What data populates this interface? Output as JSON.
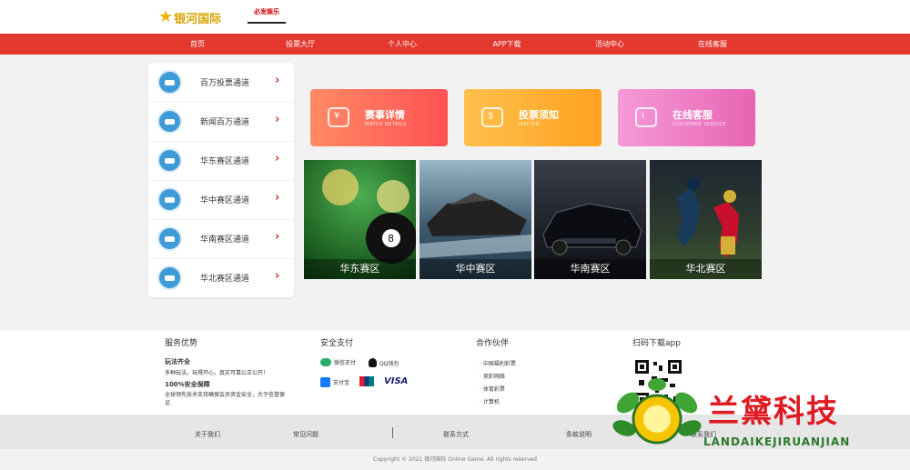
{
  "header": {
    "logo_text": "银河国际",
    "slogan": "必发娱乐"
  },
  "nav": {
    "items": [
      "首页",
      "投票大厅",
      "个人中心",
      "APP下载",
      "活动中心",
      "在线客服"
    ]
  },
  "sidebar": {
    "items": [
      {
        "label": "百万投票通道"
      },
      {
        "label": "新闻百万通道"
      },
      {
        "label": "华东赛区通道"
      },
      {
        "label": "华中赛区通道"
      },
      {
        "label": "华南赛区通道"
      },
      {
        "label": "华北赛区通道"
      }
    ]
  },
  "cards": [
    {
      "title": "赛事详情",
      "subtitle": "MATCH DETAILS",
      "icon": "wallet-icon",
      "color_start": "#ff7e5f",
      "color_end": "#ff4d4d"
    },
    {
      "title": "投票须知",
      "subtitle": "MATTER",
      "icon": "money-hand-icon",
      "color_start": "#ffb347",
      "color_end": "#ff9f1a"
    },
    {
      "title": "在线客服",
      "subtitle": "CUSTOMER SERVICE",
      "icon": "support-icon",
      "color_start": "#f08bd6",
      "color_end": "#e45fae"
    }
  ],
  "tiles": [
    {
      "caption": "华东赛区",
      "image": "billiard-ball-photo"
    },
    {
      "caption": "华中赛区",
      "image": "yacht-photo"
    },
    {
      "caption": "华南赛区",
      "image": "sports-car-photo"
    },
    {
      "caption": "华北赛区",
      "image": "football-player-photo"
    }
  ],
  "footer": {
    "service": {
      "heading": "服务优势",
      "item1_title": "玩法齐全",
      "item1_desc": "多种玩法，玩得开心，真实可靠公正公开！",
      "item2_title": "100%安全保障",
      "item2_desc": "全球领先技术支持确保会员资金安全，大于信誉保证"
    },
    "payment": {
      "heading": "安全支付",
      "wechat": "微信支付",
      "qq": "QQ钱包",
      "alipay": "支付宝",
      "unionpay": "银联",
      "visa": "VISA"
    },
    "partners": {
      "heading": "合作伙伴",
      "items": [
        "· 中国福利彩票",
        "· 竞彩网络",
        "· 体育彩票",
        "· 计算机"
      ]
    },
    "download": {
      "heading": "扫码下载app"
    },
    "links": [
      "关于我们",
      "常见问题",
      "联系方式",
      "条款说明",
      "联系我们"
    ],
    "copyright": "Copyright © 2021 银河国际 Online Game. All rights reserved"
  },
  "watermark": {
    "brand": "兰黛科技",
    "brand_sub": "LANDAIKEJIRUANJIAN"
  },
  "colors": {
    "primary_red": "#e4382e",
    "sidebar_badge": "#3f9ad8",
    "watermark_red": "#e01a22",
    "watermark_green": "#2a7a2a"
  }
}
